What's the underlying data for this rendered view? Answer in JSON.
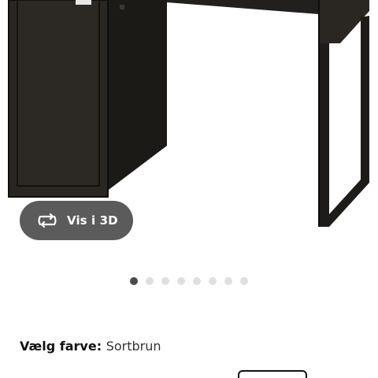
{
  "product": {
    "image_name": "micke-desk-black-brown"
  },
  "view_3d": {
    "label": "Vis i 3D",
    "icon": "rotate-3d-icon"
  },
  "carousel": {
    "total": 8,
    "active_index": 0
  },
  "color": {
    "label": "Vælg farve:",
    "value": "Sortbrun"
  },
  "colors": {
    "desk": "#272420",
    "desk_edge": "#0f0e0c",
    "button_bg": "#5b5b5b",
    "dot_active": "#4a4a4a",
    "dot_inactive": "#dfdfdf"
  }
}
